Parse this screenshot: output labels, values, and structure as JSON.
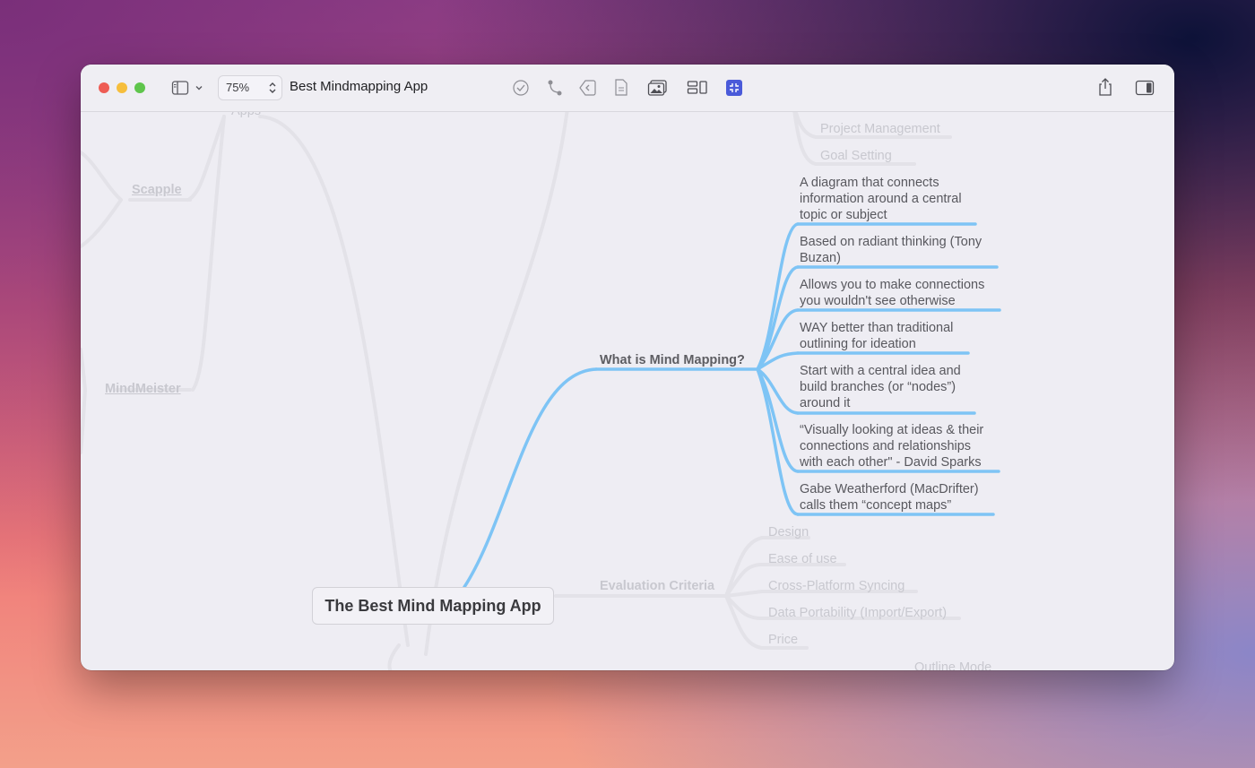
{
  "window": {
    "title": "Best Mindmapping App",
    "zoom": "75%"
  },
  "toolbar": {
    "icons": [
      "sidebar-icon",
      "chevron-down-icon",
      "stepper-icon",
      "checkmark-icon",
      "connect-icon",
      "focus-icon",
      "note-icon",
      "image-icon",
      "layout-icon",
      "collapse-icon",
      "share-icon",
      "inspector-icon"
    ],
    "accent": "#4a5ad9"
  },
  "map": {
    "central": "The Best Mind Mapping App",
    "branch_color": "#7ec4f5",
    "faint_nodes": {
      "apps": "Apps",
      "scapple": "Scapple",
      "mindmeister": "MindMeister",
      "project_management": "Project Management",
      "goal_setting": "Goal Setting",
      "outline_mode": "Outline Mode"
    },
    "what_is": {
      "label": "What is Mind Mapping?",
      "children": [
        [
          "A diagram that connects",
          "information around a central",
          "topic or subject"
        ],
        [
          "Based on radiant thinking (Tony",
          "Buzan)"
        ],
        [
          "Allows you to make connections",
          "you wouldn't see otherwise"
        ],
        [
          "WAY better than traditional",
          "outlining for ideation"
        ],
        [
          "Start with a central idea and",
          "build branches (or “nodes”)",
          "around it"
        ],
        [
          "“Visually looking at ideas & their",
          "connections and relationships",
          "with each other\" - David Sparks"
        ],
        [
          "Gabe Weatherford (MacDrifter)",
          "calls them “concept maps”"
        ]
      ]
    },
    "evaluation": {
      "label": "Evaluation Criteria",
      "children": [
        "Design",
        "Ease of use",
        "Cross-Platform Syncing",
        "Data Portability (Import/Export)",
        "Price"
      ]
    }
  }
}
